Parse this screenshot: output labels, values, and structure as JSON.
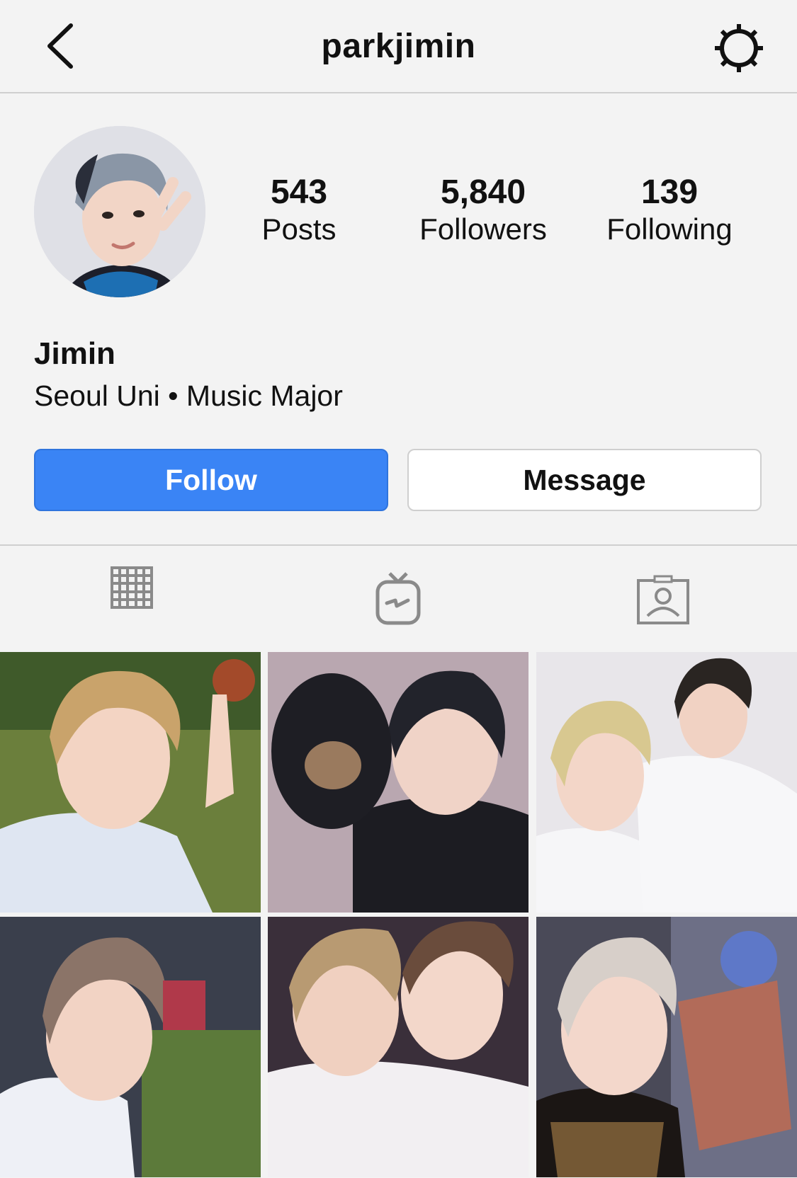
{
  "nav": {
    "title": "parkjimin"
  },
  "profile": {
    "display_name": "Jimin",
    "bio": "Seoul Uni • Music Major",
    "stats": [
      {
        "value": "543",
        "label": "Posts"
      },
      {
        "value": "5,840",
        "label": "Followers"
      },
      {
        "value": "139",
        "label": "Following"
      }
    ]
  },
  "actions": {
    "follow_label": "Follow",
    "message_label": "Message"
  },
  "tabs": [
    {
      "icon": "grid-icon",
      "selected": false
    },
    {
      "icon": "igtv-icon",
      "selected": false
    },
    {
      "icon": "tagged-icon",
      "selected": false
    }
  ],
  "colors": {
    "accent": "#3a84f5",
    "background": "#f3f3f3",
    "divider": "#cfcfcf"
  },
  "photos": [
    {
      "icon": "photo-thumbnail"
    },
    {
      "icon": "photo-thumbnail"
    },
    {
      "icon": "photo-thumbnail"
    },
    {
      "icon": "photo-thumbnail"
    },
    {
      "icon": "photo-thumbnail"
    },
    {
      "icon": "photo-thumbnail"
    }
  ]
}
